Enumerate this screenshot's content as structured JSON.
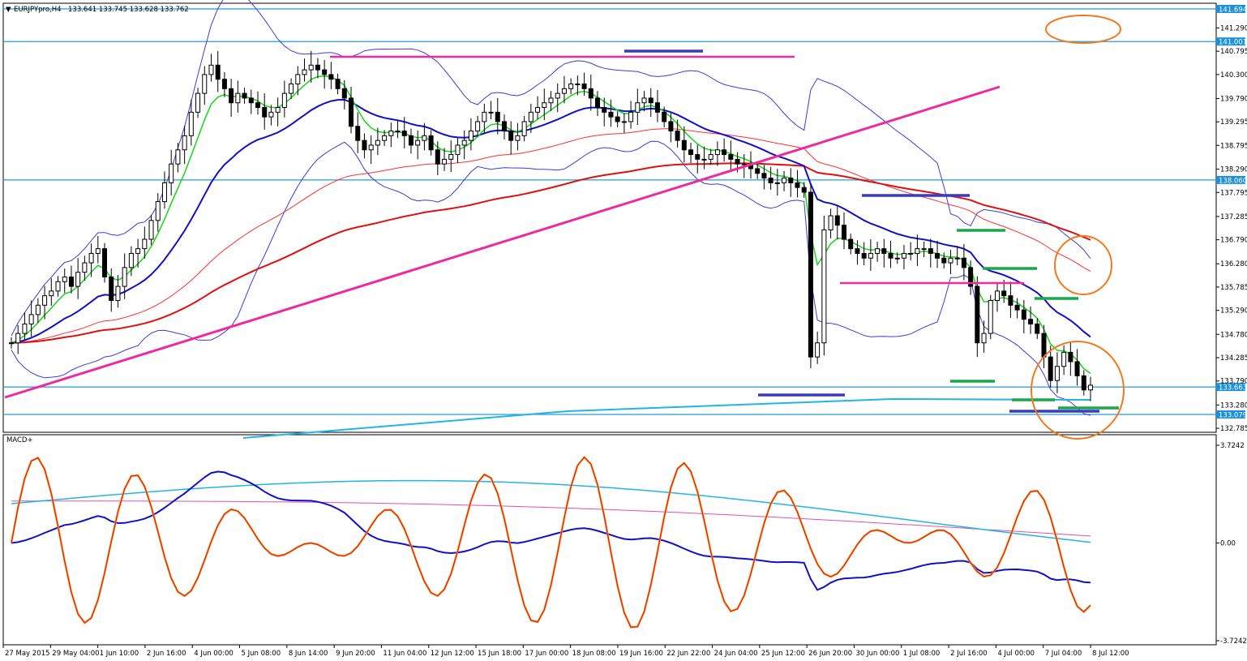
{
  "window": {
    "symbol_header": "EURJPYpro,H4",
    "header_prices": "133.641 133.745 133.628 133.762"
  },
  "colors": {
    "background": "#ffffff",
    "candle": "#000000",
    "level_line": "#1e9fd8",
    "level_tag": "#1e90d8",
    "bollinger": "#3b3bd8",
    "ema_fast": "#19d419",
    "ema_mid": "#1010c8",
    "ema_slow": "#e01010",
    "ema_thin": "#ff3030",
    "cyan_ma": "#22b4e6",
    "magenta": "#ee2a9e",
    "support_green": "#1aa64a",
    "support_blue": "#3a3ac8",
    "annotation": "#f07a1e",
    "macd_osc": "#f59a2a",
    "macd_signal": "#e01010",
    "macd_slow": "#1010c8",
    "macd_trend1": "#22b4e6",
    "macd_trend2": "#e050b0"
  },
  "chart_data": [
    {
      "type": "candlestick",
      "title": "EURJPYpro,H4",
      "ohlc_header": [
        133.641,
        133.745,
        133.628,
        133.762
      ],
      "y_axis_ticks": [
        "141.290",
        "140.795",
        "140.300",
        "139.790",
        "139.295",
        "138.795",
        "138.290",
        "137.795",
        "137.285",
        "136.790",
        "136.280",
        "135.785",
        "135.290",
        "134.780",
        "134.285",
        "133.790",
        "133.280",
        "132.785"
      ],
      "price_tags": [
        "141.694",
        "141.001",
        "138.060",
        "133.663",
        "133.079"
      ],
      "x_axis_ticks": [
        "27 May 2015",
        "29 May 04:00",
        "1 Jun 10:00",
        "2 Jun 16:00",
        "4 Jun 00:00",
        "5 Jun 08:00",
        "8 Jun 14:00",
        "9 Jun 20:00",
        "11 Jun 04:00",
        "12 Jun 12:00",
        "15 Jun 18:00",
        "17 Jun 00:00",
        "18 Jun 08:00",
        "19 Jun 16:00",
        "22 Jun 22:00",
        "24 Jun 04:00",
        "25 Jun 12:00",
        "26 Jun 20:00",
        "30 Jun 00:00",
        "1 Jul 08:00",
        "2 Jul 16:00",
        "4 Jul 00:00",
        "7 Jul 04:00",
        "8 Jul 12:00"
      ],
      "ylim": [
        132.6,
        141.9
      ],
      "horizontal_levels": [
        141.694,
        141.001,
        138.06,
        133.663,
        133.079
      ],
      "close": [
        134.6,
        134.8,
        135.0,
        135.2,
        135.4,
        135.6,
        135.7,
        135.9,
        136.0,
        135.8,
        136.1,
        136.3,
        136.5,
        136.6,
        136.0,
        135.5,
        135.8,
        136.2,
        136.5,
        136.6,
        136.8,
        137.2,
        137.6,
        138.0,
        138.4,
        138.7,
        139.0,
        139.5,
        139.9,
        140.3,
        140.5,
        140.2,
        140.0,
        139.7,
        139.9,
        139.8,
        139.7,
        139.6,
        139.4,
        139.5,
        139.6,
        139.9,
        140.1,
        140.3,
        140.4,
        140.5,
        140.4,
        140.3,
        140.2,
        140.0,
        139.8,
        139.2,
        138.9,
        138.7,
        138.8,
        138.9,
        139.0,
        139.1,
        139.1,
        139.0,
        138.8,
        138.9,
        139.0,
        138.7,
        138.4,
        138.5,
        138.6,
        138.8,
        138.9,
        139.1,
        139.3,
        139.5,
        139.5,
        139.3,
        139.1,
        138.9,
        139.0,
        139.3,
        139.5,
        139.6,
        139.7,
        139.8,
        139.9,
        140.0,
        140.1,
        140.1,
        140.0,
        139.8,
        139.6,
        139.5,
        139.4,
        139.3,
        139.3,
        139.5,
        139.7,
        139.8,
        139.7,
        139.5,
        139.3,
        139.1,
        138.9,
        138.7,
        138.6,
        138.5,
        138.5,
        138.6,
        138.7,
        138.6,
        138.5,
        138.4,
        138.4,
        138.3,
        138.2,
        138.1,
        138.0,
        138.0,
        138.1,
        138.0,
        137.9,
        137.8,
        134.3,
        134.6,
        137.0,
        137.3,
        137.1,
        136.8,
        136.6,
        136.5,
        136.4,
        136.5,
        136.6,
        136.5,
        136.4,
        136.4,
        136.5,
        136.5,
        136.6,
        136.6,
        136.5,
        136.4,
        136.3,
        136.4,
        136.4,
        136.2,
        135.8,
        134.6,
        134.8,
        135.5,
        135.7,
        135.6,
        135.4,
        135.3,
        135.1,
        135.0,
        134.8,
        134.3,
        133.8,
        134.1,
        134.4,
        134.2,
        133.9,
        133.6,
        133.7
      ],
      "series": [
        {
          "name": "MACD+"
        },
        {
          "name": "Bollinger Bands"
        }
      ]
    },
    {
      "type": "line",
      "title": "MACD+",
      "y_axis_ticks": [
        "3.7242",
        "0.00",
        "-3.7242"
      ],
      "ylim": [
        -3.7242,
        3.7242
      ]
    }
  ]
}
